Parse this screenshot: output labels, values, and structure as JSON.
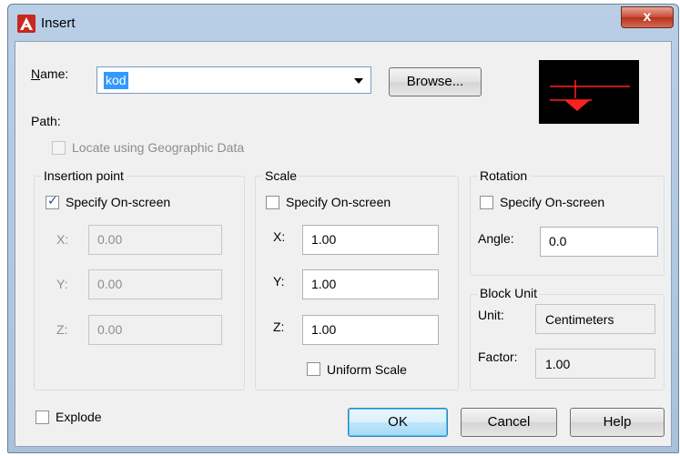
{
  "window": {
    "title": "Insert",
    "close_label": "x"
  },
  "name": {
    "label": "Name:",
    "value": "kod"
  },
  "browse_label": "Browse...",
  "path_label": "Path:",
  "geo": {
    "label": "Locate using Geographic Data",
    "checked": false,
    "enabled": false
  },
  "insertion": {
    "title": "Insertion point",
    "specify_label": "Specify On-screen",
    "specify_checked": true,
    "x_label": "X:",
    "x_value": "0.00",
    "y_label": "Y:",
    "y_value": "0.00",
    "z_label": "Z:",
    "z_value": "0.00"
  },
  "scale": {
    "title": "Scale",
    "specify_label": "Specify On-screen",
    "specify_checked": false,
    "x_label": "X:",
    "x_value": "1.00",
    "y_label": "Y:",
    "y_value": "1.00",
    "z_label": "Z:",
    "z_value": "1.00",
    "uniform_label": "Uniform Scale",
    "uniform_checked": false
  },
  "rotation": {
    "title": "Rotation",
    "specify_label": "Specify On-screen",
    "specify_checked": false,
    "angle_label": "Angle:",
    "angle_value": "0.0"
  },
  "block_unit": {
    "title": "Block Unit",
    "unit_label": "Unit:",
    "unit_value": "Centimeters",
    "factor_label": "Factor:",
    "factor_value": "1.00"
  },
  "explode": {
    "label": "Explode",
    "checked": false
  },
  "buttons": {
    "ok": "OK",
    "cancel": "Cancel",
    "help": "Help"
  },
  "colors": {
    "preview_bg": "#000000",
    "preview_lines": "#ff2020",
    "selection": "#3399ff"
  }
}
